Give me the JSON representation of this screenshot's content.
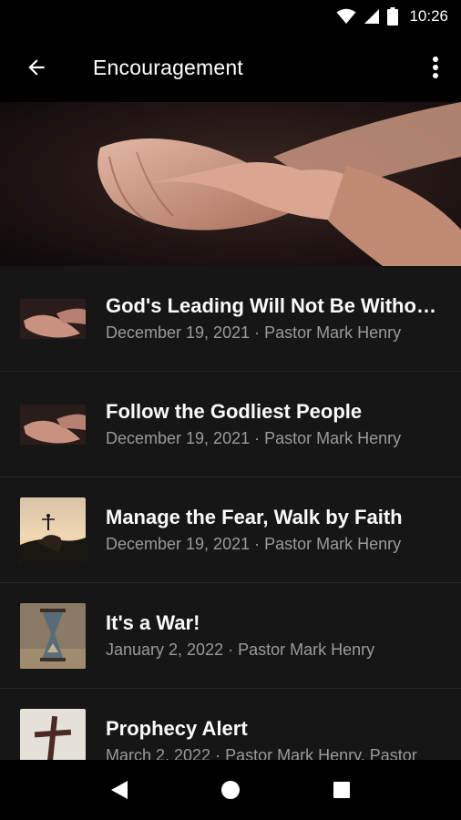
{
  "status_bar": {
    "time": "10:26",
    "icons": [
      "wifi-icon",
      "signal-icon",
      "battery-icon"
    ]
  },
  "app_bar": {
    "title": "Encouragement",
    "back_icon": "arrow-back-icon",
    "menu_icon": "more-vert-icon"
  },
  "hero": {
    "image": "praying-hands-photo"
  },
  "items": [
    {
      "title": "God's Leading Will Not Be Without Struggles",
      "subtitle": "December 19, 2021 · Pastor Mark Henry",
      "thumb": "praying-hands-photo"
    },
    {
      "title": "Follow the Godliest People",
      "subtitle": "December 19, 2021 · Pastor Mark Henry",
      "thumb": "praying-hands-photo"
    },
    {
      "title": "Manage the Fear, Walk by Faith",
      "subtitle": "December 19, 2021 · Pastor Mark Henry",
      "thumb": "sunset-cliff-photo"
    },
    {
      "title": "It's a War!",
      "subtitle": "January 2, 2022 · Pastor Mark Henry",
      "thumb": "hourglass-photo"
    },
    {
      "title": "Prophecy Alert",
      "subtitle": "March 2, 2022 · Pastor Mark Henry, Pastor",
      "thumb": "cross-photo"
    }
  ],
  "nav_bar": {
    "back_icon": "nav-back-icon",
    "home_icon": "nav-home-icon",
    "recents_icon": "nav-recents-icon"
  }
}
